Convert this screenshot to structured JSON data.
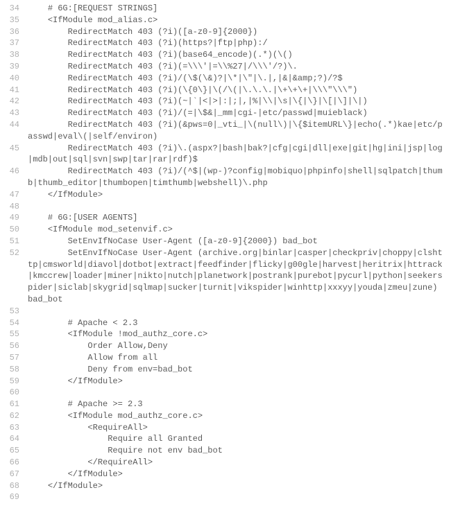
{
  "lines": [
    {
      "num": 34,
      "indent": 1,
      "text": "# 6G:[REQUEST STRINGS]"
    },
    {
      "num": 35,
      "indent": 1,
      "text": "<IfModule mod_alias.c>"
    },
    {
      "num": 36,
      "indent": 2,
      "text": "RedirectMatch 403 (?i)([a-z0-9]{2000})"
    },
    {
      "num": 37,
      "indent": 2,
      "text": "RedirectMatch 403 (?i)(https?|ftp|php):/"
    },
    {
      "num": 38,
      "indent": 2,
      "text": "RedirectMatch 403 (?i)(base64_encode)(.*)(\\()"
    },
    {
      "num": 39,
      "indent": 2,
      "text": "RedirectMatch 403 (?i)(=\\\\\\'|=\\\\%27|/\\\\\\'/?)\\."
    },
    {
      "num": 40,
      "indent": 2,
      "text": "RedirectMatch 403 (?i)/(\\$(\\&)?|\\*|\\\"|\\.|,|&|&amp;?)/?$"
    },
    {
      "num": 41,
      "indent": 2,
      "text": "RedirectMatch 403 (?i)(\\{0\\}|\\(/\\(|\\.\\.\\.|\\+\\+\\+|\\\\\\\"\\\\\\\")"
    },
    {
      "num": 42,
      "indent": 2,
      "text": "RedirectMatch 403 (?i)(~|`|<|>|:|;|,|%|\\\\|\\s|\\{|\\}|\\[|\\]|\\|)"
    },
    {
      "num": 43,
      "indent": 2,
      "text": "RedirectMatch 403 (?i)/(=|\\$&|_mm|cgi-|etc/passwd|muieblack)"
    },
    {
      "num": 44,
      "indent": 2,
      "text": "RedirectMatch 403 (?i)(&pws=0|_vti_|\\(null\\)|\\{$itemURL\\}|echo(.*)kae|etc/passwd|eval\\(|self/environ)"
    },
    {
      "num": 45,
      "indent": 2,
      "text": "RedirectMatch 403 (?i)\\.(aspx?|bash|bak?|cfg|cgi|dll|exe|git|hg|ini|jsp|log|mdb|out|sql|svn|swp|tar|rar|rdf)$"
    },
    {
      "num": 46,
      "indent": 2,
      "text": "RedirectMatch 403 (?i)/(^$|(wp-)?config|mobiquo|phpinfo|shell|sqlpatch|thumb|thumb_editor|thumbopen|timthumb|webshell)\\.php"
    },
    {
      "num": 47,
      "indent": 1,
      "text": "</IfModule>"
    },
    {
      "num": 48,
      "indent": 0,
      "text": ""
    },
    {
      "num": 49,
      "indent": 1,
      "text": "# 6G:[USER AGENTS]"
    },
    {
      "num": 50,
      "indent": 1,
      "text": "<IfModule mod_setenvif.c>"
    },
    {
      "num": 51,
      "indent": 2,
      "text": "SetEnvIfNoCase User-Agent ([a-z0-9]{2000}) bad_bot"
    },
    {
      "num": 52,
      "indent": 2,
      "text": "SetEnvIfNoCase User-Agent (archive.org|binlar|casper|checkpriv|choppy|clshttp|cmsworld|diavol|dotbot|extract|feedfinder|flicky|g00gle|harvest|heritrix|httrack|kmccrew|loader|miner|nikto|nutch|planetwork|postrank|purebot|pycurl|python|seekerspider|siclab|skygrid|sqlmap|sucker|turnit|vikspider|winhttp|xxxyy|youda|zmeu|zune) bad_bot"
    },
    {
      "num": 53,
      "indent": 0,
      "text": ""
    },
    {
      "num": 54,
      "indent": 2,
      "text": "# Apache < 2.3"
    },
    {
      "num": 55,
      "indent": 2,
      "text": "<IfModule !mod_authz_core.c>"
    },
    {
      "num": 56,
      "indent": 3,
      "text": "Order Allow,Deny"
    },
    {
      "num": 57,
      "indent": 3,
      "text": "Allow from all"
    },
    {
      "num": 58,
      "indent": 3,
      "text": "Deny from env=bad_bot"
    },
    {
      "num": 59,
      "indent": 2,
      "text": "</IfModule>"
    },
    {
      "num": 60,
      "indent": 0,
      "text": ""
    },
    {
      "num": 61,
      "indent": 2,
      "text": "# Apache >= 2.3"
    },
    {
      "num": 62,
      "indent": 2,
      "text": "<IfModule mod_authz_core.c>"
    },
    {
      "num": 63,
      "indent": 3,
      "text": "<RequireAll>"
    },
    {
      "num": 64,
      "indent": 4,
      "text": "Require all Granted"
    },
    {
      "num": 65,
      "indent": 4,
      "text": "Require not env bad_bot"
    },
    {
      "num": 66,
      "indent": 3,
      "text": "</RequireAll>"
    },
    {
      "num": 67,
      "indent": 2,
      "text": "</IfModule>"
    },
    {
      "num": 68,
      "indent": 1,
      "text": "</IfModule>"
    },
    {
      "num": 69,
      "indent": 0,
      "text": ""
    }
  ],
  "indent_unit": "    "
}
